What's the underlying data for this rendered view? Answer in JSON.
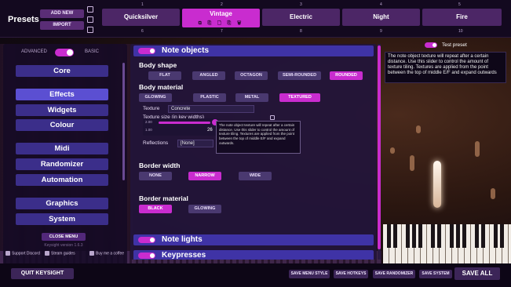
{
  "top": {
    "presets_title": "Presets",
    "add_new": "ADD NEW",
    "import": "IMPORT",
    "slots": [
      {
        "label": "Quicksilver",
        "num_top": "1",
        "num_bottom": "6"
      },
      {
        "label": "Vintage",
        "num_top": "2",
        "num_bottom": "7",
        "active": true
      },
      {
        "label": "Electric",
        "num_top": "3",
        "num_bottom": "8"
      },
      {
        "label": "Night",
        "num_top": "4",
        "num_bottom": "9"
      },
      {
        "label": "Fire",
        "num_top": "5",
        "num_bottom": "10"
      }
    ],
    "active_slot_icons": "⧉ ⎘ 🗋 ⎘ 🗑"
  },
  "sidebar": {
    "advanced": "ADVANCED",
    "basic": "BASIC",
    "items": [
      "Core",
      "Effects",
      "Widgets",
      "Colour",
      "Midi",
      "Randomizer",
      "Automation",
      "Graphics",
      "System"
    ],
    "active_item": "Effects",
    "close_menu": "CLOSE MENU",
    "version": "Keysight version 1.6.3",
    "support_discord": "Support Discord",
    "steam_guides": "Steam guides",
    "buy_coffee": "Buy me a coffee"
  },
  "panel": {
    "note_objects": "Note objects",
    "body_shape": "Body shape",
    "shapes": [
      "FLAT",
      "ANGLED",
      "OCTAGON",
      "SEMI-ROUNDED",
      "ROUNDED"
    ],
    "shape_selected": "ROUNDED",
    "body_material": "Body material",
    "materials": [
      "GLOWING",
      "PLASTIC",
      "METAL",
      "TEXTURED"
    ],
    "material_selected": "TEXTURED",
    "texture_label": "Texture",
    "texture_value": "Concrete",
    "texture_size_label": "Texture size (in key widths)",
    "slider_min": "2.00",
    "slider_mid": "1.00",
    "slider_value": "26",
    "tooltip": "The note object texture will repeat after a certain distance. Use this slider to control the amount of texture tiling. Textures are applied from the point between the top of middle E/F and expand outwards.",
    "reflections_label": "Reflections",
    "reflections_value": "[None]",
    "border_width": "Border width",
    "border_widths": [
      "NONE",
      "NARROW",
      "WIDE"
    ],
    "border_width_selected": "NARROW",
    "border_material": "Border material",
    "border_materials": [
      "BLACK",
      "GLOWING"
    ],
    "border_material_selected": "BLACK",
    "note_lights": "Note lights",
    "keypresses": "Keypresses"
  },
  "right": {
    "test_preset": "Test preset",
    "info": "The note object texture will repeat after a certain distance. Use this slider to control the amount of texture tiling. Textures are applied from the point between the top of middle E/F and expand outwards"
  },
  "bottom": {
    "quit": "QUIT KEYSIGHT",
    "save_menu_style": "SAVE MENU STYLE",
    "save_hotkeys": "SAVE HOTKEYS",
    "save_randomizer": "SAVE RANDOMIZER",
    "save_system": "SAVE SYSTEM",
    "save_all": "SAVE ALL"
  },
  "colors": {
    "accent": "#c92ccf",
    "nav": "#3b2e8a",
    "nav_active": "#5b4fd2",
    "header": "#3f33a6"
  }
}
